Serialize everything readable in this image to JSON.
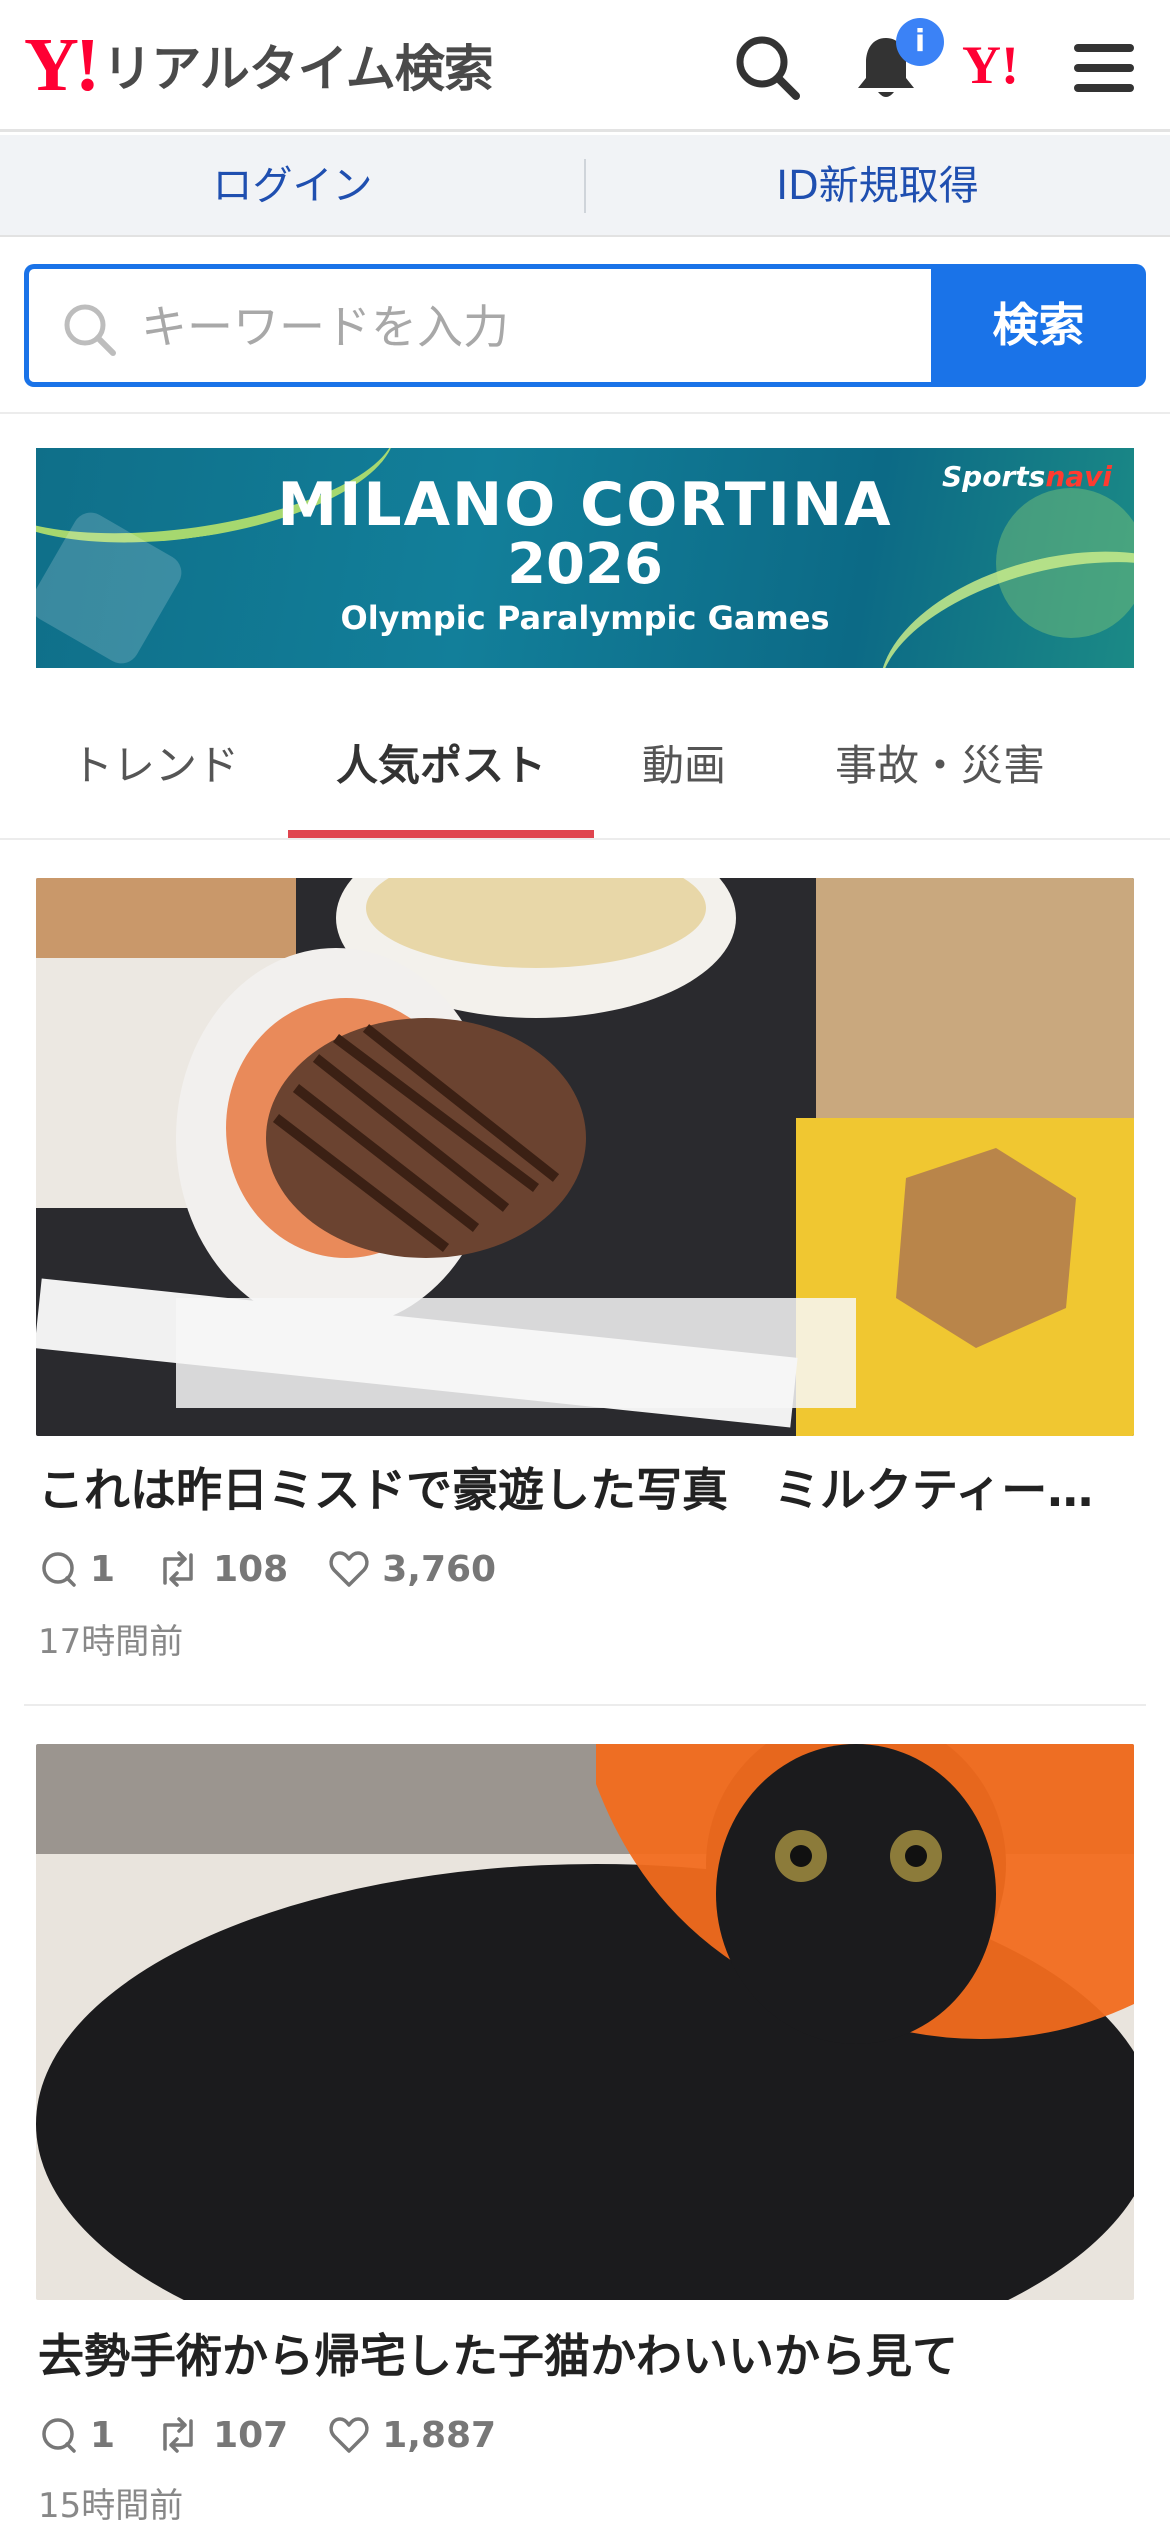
{
  "header": {
    "logo_mark": "Y!",
    "app_title": "リアルタイム検索",
    "notification_badge": "i",
    "yahoo_mark": "Y!",
    "icons": [
      "search-icon",
      "bell-icon",
      "yahoo-japan-icon",
      "menu-icon"
    ]
  },
  "login_bar": {
    "login_label": "ログイン",
    "signup_label": "ID新規取得"
  },
  "search": {
    "placeholder": "キーワードを入力",
    "button_label": "検索"
  },
  "banner": {
    "title": "MILANO CORTINA",
    "year": "2026",
    "subtitle": "Olympic Paralympic Games",
    "brand_prefix": "Sports",
    "brand_suffix": "navi"
  },
  "tabs": [
    {
      "label": "トレンド",
      "active": false
    },
    {
      "label": "人気ポスト",
      "active": true
    },
    {
      "label": "動画",
      "active": false
    },
    {
      "label": "事故・災害",
      "active": false
    }
  ],
  "posts": [
    {
      "image": "photo of donuts, milk tea and noodles on a tray",
      "title": "これは昨日ミスドで豪遊した写真　ミルクティー…",
      "replies": "1",
      "reposts": "108",
      "likes": "3,760",
      "time": "17時間前"
    },
    {
      "image": "photo of a black kitten wearing an orange cone collar",
      "title": "去勢手術から帰宅した子猫かわいいから見て",
      "replies": "1",
      "reposts": "107",
      "likes": "1,887",
      "time": "15時間前"
    }
  ],
  "colors": {
    "brand_red": "#ff0033",
    "link_blue": "#1f4fb0",
    "search_blue": "#1a73e8",
    "tab_underline": "#e0454f"
  }
}
